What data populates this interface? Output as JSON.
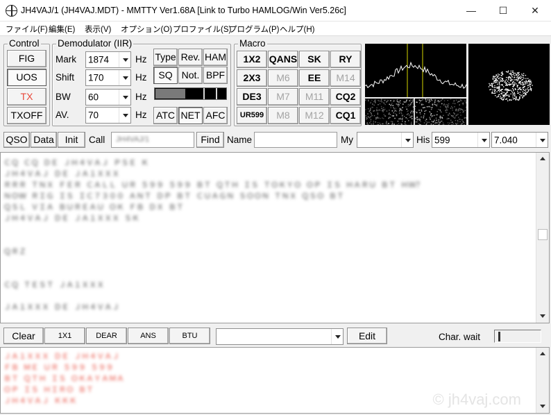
{
  "window": {
    "title": "JH4VAJ/1 (JH4VAJ.MDT) - MMTTY Ver1.68A [Link to Turbo HAMLOG/Win Ver5.26c]",
    "minimize": "—",
    "maximize": "☐",
    "close": "✕"
  },
  "menu": [
    "ファイル(F)",
    "編集(E)",
    "表示(V)",
    "オプション(O)",
    "プロファイル(S)",
    "プログラム(P)",
    "ヘルプ(H)"
  ],
  "control": {
    "title": "Control",
    "fig": "FIG",
    "uos": "UOS",
    "tx": "TX",
    "txoff": "TXOFF"
  },
  "demod": {
    "title": "Demodulator (IIR)",
    "mark_label": "Mark",
    "mark_value": "1874",
    "shift_label": "Shift",
    "shift_value": "170",
    "bw_label": "BW",
    "bw_value": "60",
    "av_label": "AV.",
    "av_value": "70",
    "hz": "Hz",
    "type": "Type",
    "rev": "Rev.",
    "ham": "HAM",
    "sq": "SQ",
    "not": "Not.",
    "bpf": "BPF",
    "atc": "ATC",
    "net": "NET",
    "afc": "AFC",
    "squelch_level": 0.42
  },
  "macro": {
    "title": "Macro",
    "buttons": [
      [
        "1X2",
        "QANS",
        "SK",
        "RY"
      ],
      [
        "2X3",
        "M6",
        "EE",
        "M14"
      ],
      [
        "DE3",
        "M7",
        "M11",
        "CQ2"
      ],
      [
        "UR599",
        "M8",
        "M12",
        "CQ1"
      ]
    ]
  },
  "log": {
    "qso": "QSO",
    "data": "Data",
    "init": "Init",
    "call_label": "Call",
    "call_value": "JH4VAJ/1",
    "find": "Find",
    "name_label": "Name",
    "name_value": "",
    "my_label": "My",
    "my_value": "",
    "his_label": "His",
    "his_value": "599",
    "freq_value": "7.040"
  },
  "rx_text": [
    "ＣＱ ＣＱ ＤＥ ＪＨ４ＶＡＪ ＰＳＥ Ｋ",
    "ＪＨ４ＶＡＪ ＤＥ ＪＡ１ＸＸＸ",
    "ＲＲＲ ＴＮＸ ＦＥＲ ＣＡＬＬ ＵＲ ５９９ ５９９ ＢＴ ＱＴＨ ＩＳ ＴＯＫＹＯ ＯＰ ＩＳ ＨＡＲＵ ＢＴ ＨＷ？",
    "ＮＯＷ ＲＩＧ ＩＳ ＩＣ７３００ ＡＮＴ ＤＰ ＢＴ ＣＵＡＧＮ ＳＯＯＮ ＴＮＸ ＱＳＯ ＢＴ",
    "ＱＳＬ ＶＩＡ ＢＵＲＥＡＵ ＯＫ ＦＢ ＤＸ ＢＴ",
    "ＪＨ４ＶＡＪ ＤＥ ＪＡ１ＸＸＸ ＳＫ",
    "",
    "",
    "ＱＲＺ",
    "",
    "",
    "ＣＱ ＴＥＳＴ ＪＡ１ＸＸＸ",
    "",
    "ＪＡ１ＸＸＸ ＤＥ ＪＨ４ＶＡＪ"
  ],
  "tx_toolbar": {
    "clear": "Clear",
    "b1": "1X1",
    "b2": "DEAR",
    "b3": "ANS",
    "b4": "BTU",
    "combo_value": "",
    "edit": "Edit",
    "char_wait": "Char. wait",
    "char_wait_level": 0.05
  },
  "tx_text": [
    "ＪＡ１ＸＸＸ ＤＥ ＪＨ４ＶＡＪ",
    "ＦＢ ＭＥ ＵＲ ５９９ ５９９",
    "ＢＴ ＱＴＨ ＩＳ ＯＫＡＹＡＭＡ",
    "ＯＰ ＩＳ ＨＩＲＯ ＢＴ",
    "ＪＨ４ＶＡＪ ＫＫＫ"
  ],
  "watermark": "© jh4vaj.com",
  "colors": {
    "tx_red": "#e8483a",
    "scope_yellow": "#d6d600"
  }
}
